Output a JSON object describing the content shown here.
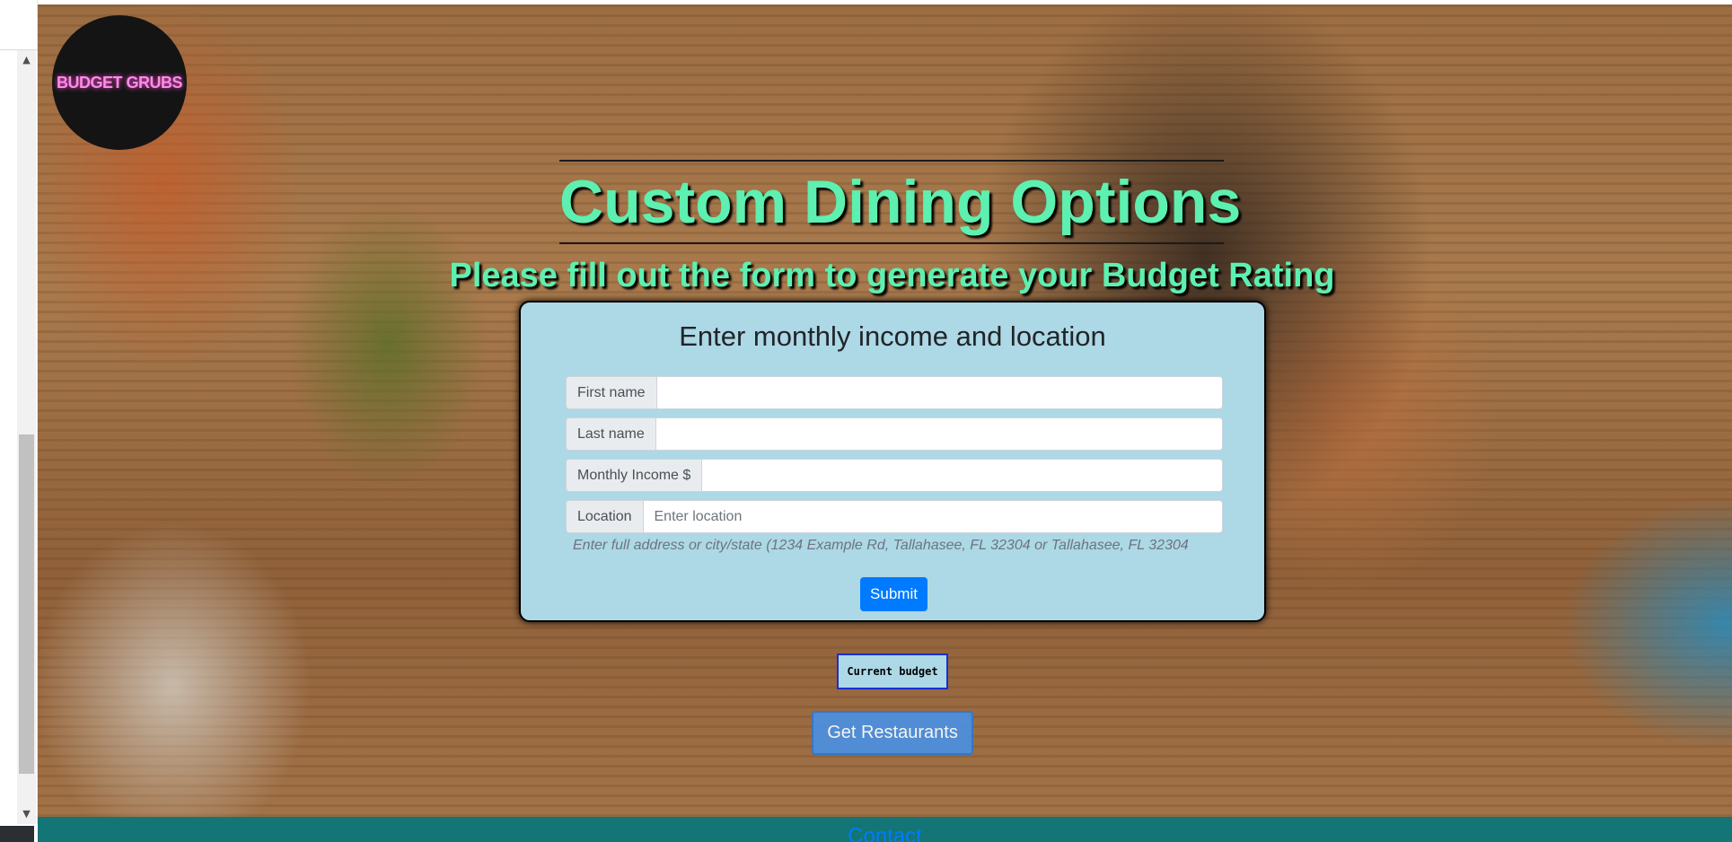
{
  "logo": {
    "text": "BUDGET GRUBS"
  },
  "header": {
    "title": "Custom Dining Options",
    "subtitle": "Please fill out the form to generate your Budget Rating"
  },
  "form": {
    "heading": "Enter monthly income and location",
    "fields": [
      {
        "label": "First name",
        "value": "",
        "placeholder": ""
      },
      {
        "label": "Last name",
        "value": "",
        "placeholder": ""
      },
      {
        "label": "Monthly Income $",
        "value": "",
        "placeholder": ""
      },
      {
        "label": "Location",
        "value": "",
        "placeholder": "Enter location"
      }
    ],
    "help_text": "Enter full address or city/state (1234 Example Rd, Tallahasee, FL 32304 or Tallahasee, FL 32304",
    "submit_label": "Submit"
  },
  "budget": {
    "label": "Current budget"
  },
  "restaurants_button": {
    "label": "Get Restaurants"
  },
  "footer": {
    "contact_label": "Contact"
  },
  "colors": {
    "title": "#5df0b0",
    "card": "#add8e6",
    "primary": "#007bff",
    "footer": "#137575"
  },
  "icons": [
    "scroll-up-arrow-icon",
    "scroll-down-arrow-icon"
  ]
}
